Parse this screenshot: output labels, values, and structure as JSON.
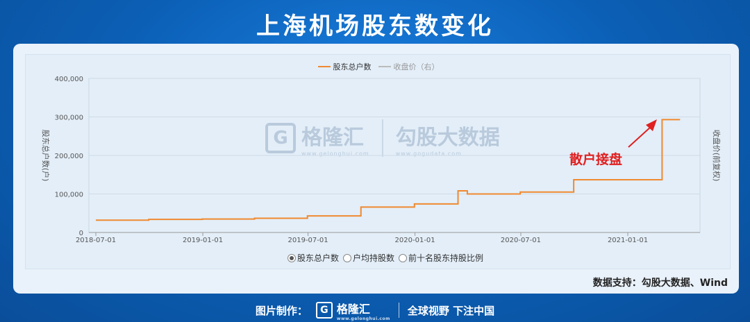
{
  "title": "上海机场股东数变化",
  "legend": {
    "items": [
      {
        "label": "股东总户数",
        "color": "#f0892f"
      },
      {
        "label": "收盘价（右）",
        "color": "#bbbbbb"
      }
    ]
  },
  "watermark": {
    "brand": "格隆汇",
    "brand_url": "www.gelonghui.com",
    "partner": "勾股大数据",
    "partner_url": "www.gogudata.com"
  },
  "radios": [
    {
      "label": "股东总户数",
      "checked": true
    },
    {
      "label": "户均持股数",
      "checked": false
    },
    {
      "label": "前十名股东持股比例",
      "checked": false
    }
  ],
  "annotation": "散户接盘",
  "source": "数据支持：勾股大数据、Wind",
  "footer": {
    "made_by": "图片制作：",
    "brand": "格隆汇",
    "brand_url": "www.gelonghui.com",
    "slogan": "全球视野 下注中国"
  },
  "chart_data": {
    "type": "line",
    "ylabel_left": "股东总户数(户)",
    "ylabel_right": "收盘价(前复权)",
    "ylim": [
      0,
      400000
    ],
    "yticks": [
      0,
      100000,
      200000,
      300000,
      400000
    ],
    "ytick_labels": [
      "0",
      "100,000",
      "200,000",
      "300,000",
      "400,000"
    ],
    "xticks": [
      "2018-07-01",
      "2019-01-01",
      "2019-07-01",
      "2020-01-01",
      "2020-07-01",
      "2021-01-01"
    ],
    "xlim": [
      "2018-07-01",
      "2021-04-01"
    ],
    "grid": true,
    "series": [
      {
        "name": "股东总户数",
        "color": "#f0892f",
        "step": true,
        "points": [
          [
            "2018-07-01",
            32000
          ],
          [
            "2018-09-30",
            34000
          ],
          [
            "2018-12-31",
            35000
          ],
          [
            "2019-03-31",
            37000
          ],
          [
            "2019-06-30",
            43000
          ],
          [
            "2019-09-30",
            66000
          ],
          [
            "2019-12-31",
            74000
          ],
          [
            "2020-03-15",
            108000
          ],
          [
            "2020-03-31",
            100000
          ],
          [
            "2020-06-30",
            105000
          ],
          [
            "2020-09-30",
            137000
          ],
          [
            "2020-12-31",
            137000
          ],
          [
            "2021-03-01",
            293000
          ],
          [
            "2021-04-01",
            293000
          ]
        ]
      }
    ]
  }
}
